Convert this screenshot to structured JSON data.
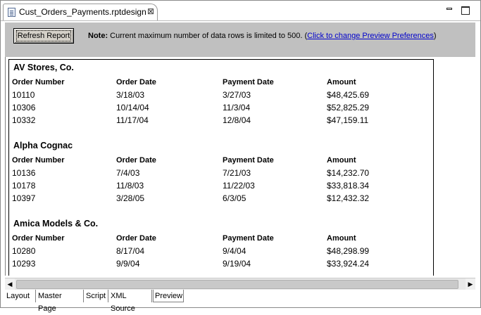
{
  "editor_tab": {
    "title": "Cust_Orders_Payments.rptdesign",
    "close": "⊠",
    "icon": "report-file-icon"
  },
  "toolbar": {
    "refresh_label": "Refresh Report",
    "note_label": "Note:",
    "note_text": " Current maximum number of data rows is limited to 500. (",
    "note_link": "Click to change Preview Preferences",
    "note_end": ")"
  },
  "columns": [
    "Order Number",
    "Order Date",
    "Payment Date",
    "Amount"
  ],
  "customers": [
    {
      "name": "AV Stores, Co.",
      "rows": [
        [
          "10110",
          "3/18/03",
          "3/27/03",
          "$48,425.69"
        ],
        [
          "10306",
          "10/14/04",
          "11/3/04",
          "$52,825.29"
        ],
        [
          "10332",
          "11/17/04",
          "12/8/04",
          "$47,159.11"
        ]
      ]
    },
    {
      "name": "Alpha Cognac",
      "rows": [
        [
          "10136",
          "7/4/03",
          "7/21/03",
          "$14,232.70"
        ],
        [
          "10178",
          "11/8/03",
          "11/22/03",
          "$33,818.34"
        ],
        [
          "10397",
          "3/28/05",
          "6/3/05",
          "$12,432.32"
        ]
      ]
    },
    {
      "name": "Amica Models & Co.",
      "rows": [
        [
          "10280",
          "8/17/04",
          "9/4/04",
          "$48,298.99"
        ],
        [
          "10293",
          "9/9/04",
          "9/19/04",
          "$33,924.24"
        ]
      ]
    }
  ],
  "bottom_tabs": [
    "Layout",
    "Master Page",
    "Script",
    "XML Source",
    "Preview"
  ],
  "active_bottom_tab": "Preview"
}
